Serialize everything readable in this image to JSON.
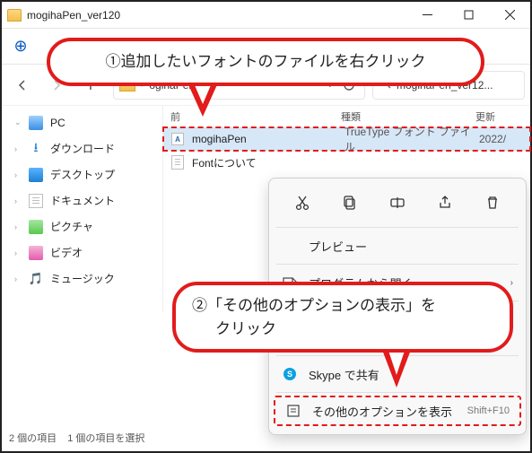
{
  "window": {
    "title": "mogihaPen_ver120"
  },
  "address": {
    "segment": "ogihaPen...",
    "search_placeholder": "mogihaPen_ver12..."
  },
  "sidebar": {
    "pc": "PC",
    "downloads": "ダウンロード",
    "desktop": "デスクトップ",
    "documents": "ドキュメント",
    "pictures": "ピクチャ",
    "videos": "ビデオ",
    "music": "ミュージック"
  },
  "filelist": {
    "headers": {
      "name": "前",
      "type": "種類",
      "date": "更新"
    },
    "rows": [
      {
        "name": "mogihaPen",
        "type": "TrueType フォント ファイル",
        "date": "2022/"
      },
      {
        "name": "Fontについて",
        "type": "",
        "date": ""
      }
    ]
  },
  "status": {
    "count": "2 個の項目",
    "selected": "1 個の項目を選択"
  },
  "context": {
    "preview": "プレビュー",
    "open_with": "プログラムから開く",
    "skype": "Skype で共有",
    "more": "その他のオプションを表示",
    "more_shortcut": "Shift+F10"
  },
  "callouts": {
    "c1": "①追加したいフォントのファイルを右クリック",
    "c2a": "②「その他のオプションの表示」を",
    "c2b": "クリック"
  }
}
